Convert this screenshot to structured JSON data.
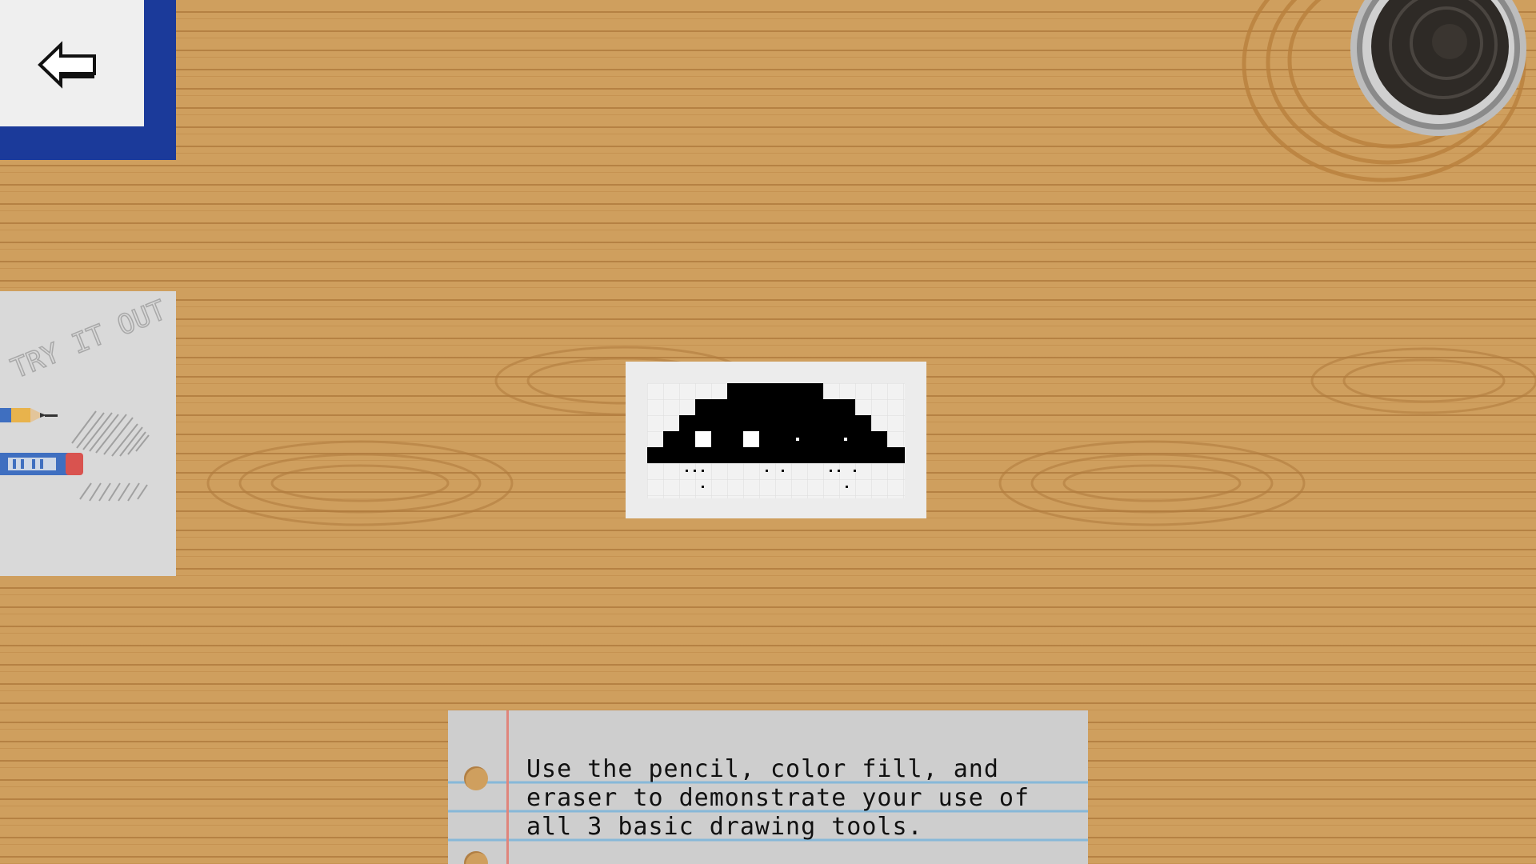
{
  "back_button": {
    "icon": "arrow-left-icon"
  },
  "try_card": {
    "caption": "TRY IT OUT",
    "icons": [
      "pencil-icon",
      "eraser-icon"
    ]
  },
  "level_thumbnail": {
    "icon": "pixel-puzzle-thumbnail",
    "grid_cols": 16,
    "grid_rows": 7
  },
  "instructions": {
    "text": "Use the pencil, color fill, and eraser to demonstrate your use of all 3 basic drawing tools."
  },
  "colors": {
    "desk": "#cf9f5e",
    "back_button_border": "#1b3a9a",
    "paper": "#cecece",
    "rule_line": "#87b8d8",
    "margin_line": "#e0857c"
  }
}
